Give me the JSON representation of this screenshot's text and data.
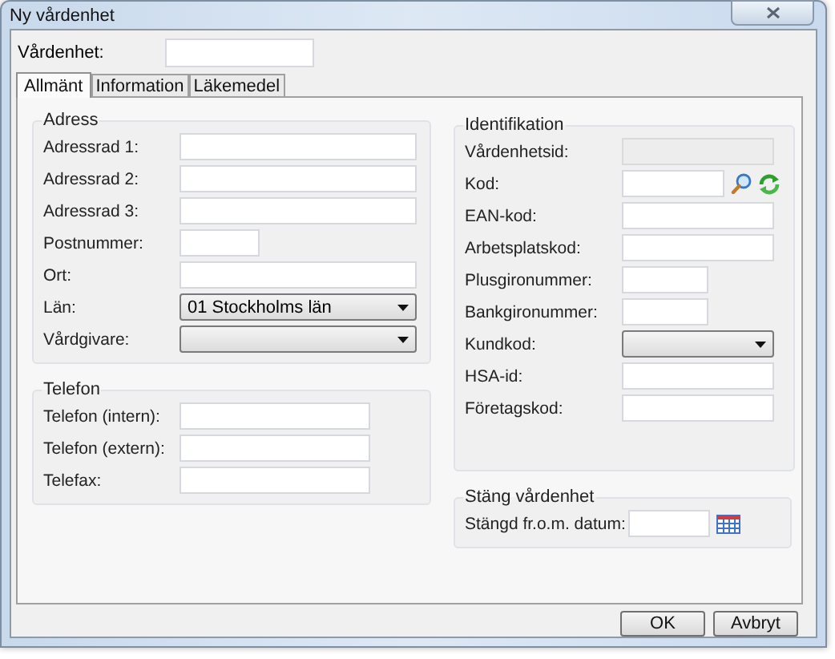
{
  "window": {
    "title": "Ny vårdenhet"
  },
  "unit_field": {
    "label": "Vårdenhet:"
  },
  "tabs": [
    {
      "label": "Allmänt",
      "selected": true
    },
    {
      "label": "Information",
      "selected": false
    },
    {
      "label": "Läkemedel",
      "selected": false
    }
  ],
  "columns": [
    [
      {
        "title": "Adress",
        "fields": [
          {
            "label": "Adressrad 1:",
            "kind": "text"
          },
          {
            "label": "Adressrad 2:",
            "kind": "text"
          },
          {
            "label": "Adressrad 3:",
            "kind": "text"
          },
          {
            "label": "Postnummer:",
            "kind": "short"
          },
          {
            "label": "Ort:",
            "kind": "text"
          },
          {
            "label": "Län:",
            "kind": "dropdown",
            "value": "01 Stockholms län"
          },
          {
            "label": "Vårdgivare:",
            "kind": "dropdown"
          }
        ]
      },
      {
        "title": "Telefon",
        "fields": [
          {
            "label": "Telefon (intern):",
            "kind": "medium"
          },
          {
            "label": "Telefon (extern):",
            "kind": "medium"
          },
          {
            "label": "Telefax:",
            "kind": "medium"
          }
        ]
      }
    ],
    [
      {
        "title": "Identifikation",
        "fields": [
          {
            "label": "Vårdenhetsid:",
            "kind": "readonly"
          },
          {
            "label": "Kod:",
            "kind": "lookup"
          },
          {
            "label": "EAN-kod:",
            "kind": "text"
          },
          {
            "label": "Arbetsplatskod:",
            "kind": "text"
          },
          {
            "label": "Plusgironummer:",
            "kind": "short"
          },
          {
            "label": "Bankgironummer:",
            "kind": "short"
          },
          {
            "label": "Kundkod:",
            "kind": "dropdown"
          },
          {
            "label": "HSA-id:",
            "kind": "text"
          },
          {
            "label": "Företagskod:",
            "kind": "text"
          }
        ]
      },
      {
        "title": "Stäng vårdenhet",
        "fields": [
          {
            "label": "Stängd fr.o.m. datum:",
            "kind": "date"
          }
        ]
      }
    ]
  ],
  "buttons": [
    "OK",
    "Avbryt"
  ]
}
